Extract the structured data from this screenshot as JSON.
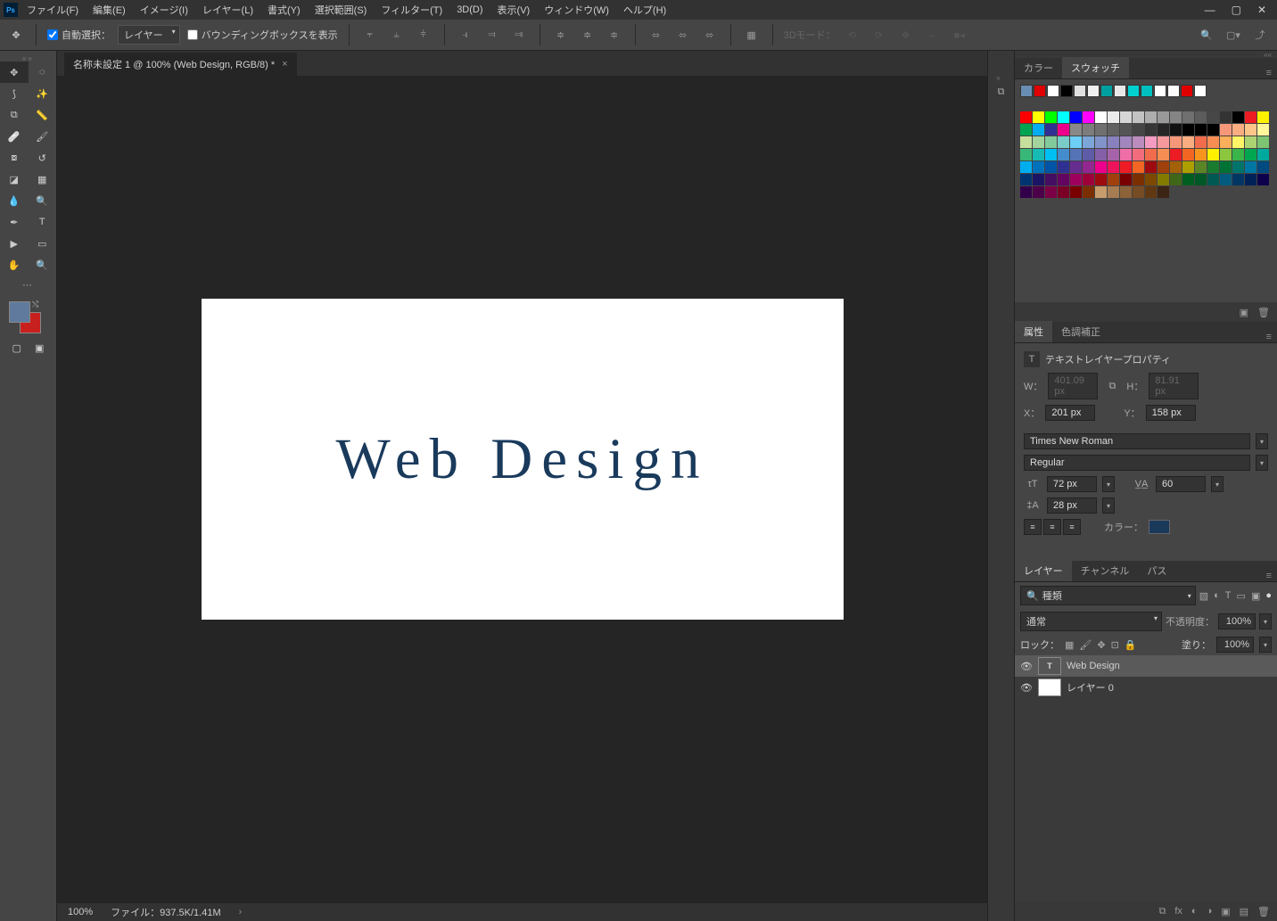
{
  "menu": {
    "items": [
      "ファイル(F)",
      "編集(E)",
      "イメージ(I)",
      "レイヤー(L)",
      "書式(Y)",
      "選択範囲(S)",
      "フィルター(T)",
      "3D(D)",
      "表示(V)",
      "ウィンドウ(W)",
      "ヘルプ(H)"
    ]
  },
  "options": {
    "auto_select": "自動選択：",
    "target": "レイヤー",
    "show_bbox": "バウンディングボックスを表示",
    "mode_3d": "3Dモード："
  },
  "document": {
    "tab_title": "名称未設定 1 @ 100% (Web Design, RGB/8) *",
    "canvas_text": "Web Design"
  },
  "status": {
    "zoom": "100%",
    "info": "ファイル：937.5K/1.41M"
  },
  "panel_color": {
    "tab1": "カラー",
    "tab2": "スウォッチ"
  },
  "panel_props": {
    "tab1": "属性",
    "tab2": "色調補正",
    "title": "テキストレイヤープロパティ",
    "w_label": "W：",
    "w_val": "401.09 px",
    "h_label": "H：",
    "h_val": "81.91 px",
    "x_label": "X：",
    "x_val": "201 px",
    "y_label": "Y：",
    "y_val": "158 px",
    "font": "Times New Roman",
    "style": "Regular",
    "size": "72 px",
    "tracking": "60",
    "leading": "28 px",
    "color_label": "カラー："
  },
  "panel_layers": {
    "tab1": "レイヤー",
    "tab2": "チャンネル",
    "tab3": "パス",
    "filter_kind": "種類",
    "blend": "通常",
    "opacity_label": "不透明度：",
    "opacity": "100%",
    "lock_label": "ロック：",
    "fill_label": "塗り：",
    "fill": "100%",
    "layers": [
      {
        "name": "Web Design",
        "type": "text"
      },
      {
        "name": "レイヤー 0",
        "type": "raster"
      }
    ]
  }
}
